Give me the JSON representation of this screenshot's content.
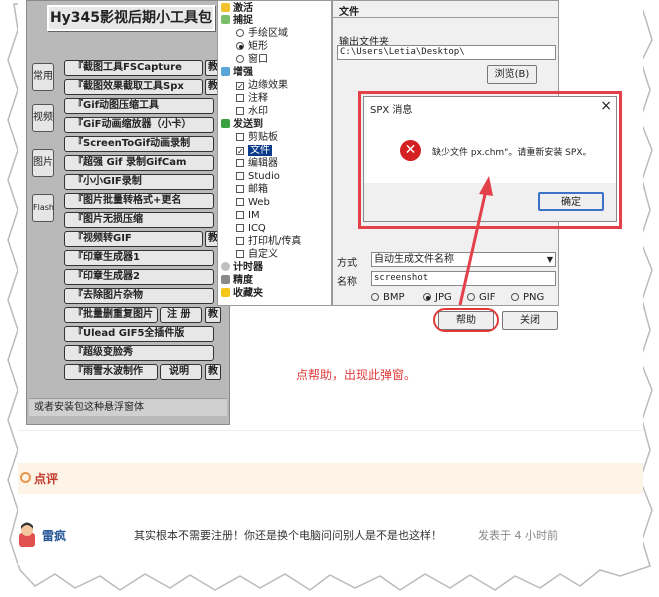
{
  "tool_panel": {
    "title": "Hy345影视后期小工具包",
    "side_buttons": [
      "常用",
      "视频",
      "图片",
      "Flash"
    ],
    "buttons": [
      {
        "label": "『截图工具FSCapture",
        "extra": "教"
      },
      {
        "label": "『截图效果截取工具Spx",
        "extra": "教"
      },
      {
        "label": "『Gif动图压缩工具",
        "extra": ""
      },
      {
        "label": "『GiF动画缩放器（小卡）",
        "extra": ""
      },
      {
        "label": "『ScreenToGif动画录制",
        "extra": ""
      },
      {
        "label": "『超强 Gif 录制GifCam",
        "extra": ""
      },
      {
        "label": "『小小GIF录制",
        "extra": ""
      },
      {
        "label": "『图片批量转格式+更名",
        "extra": ""
      },
      {
        "label": "『图片无损压缩",
        "extra": ""
      },
      {
        "label": "『视频转GIF",
        "extra": "教"
      },
      {
        "label": "『印章生成器1",
        "extra": ""
      },
      {
        "label": "『印章生成器2",
        "extra": ""
      },
      {
        "label": "『去除图片杂物",
        "extra": ""
      },
      {
        "label": "『批量删重复图片",
        "extra": "注 册",
        "extra2": "教"
      },
      {
        "label": "『Ulead GIF5全插件版",
        "extra": ""
      },
      {
        "label": "『超级变脸秀",
        "extra": ""
      },
      {
        "label": "『雨雪水波制作",
        "extra": "说明",
        "extra2": "教"
      }
    ],
    "footer": "或者安装包这种悬浮窗体"
  },
  "tree": {
    "items": [
      {
        "label": "激活",
        "kind": "section"
      },
      {
        "label": "捕捉",
        "kind": "section"
      },
      {
        "label": "手绘区域",
        "kind": "radio",
        "on": false
      },
      {
        "label": "矩形",
        "kind": "radio",
        "on": true
      },
      {
        "label": "窗口",
        "kind": "radio",
        "on": false
      },
      {
        "label": "增强",
        "kind": "section"
      },
      {
        "label": "边缘效果",
        "kind": "check",
        "on": true
      },
      {
        "label": "注释",
        "kind": "check",
        "on": false
      },
      {
        "label": "水印",
        "kind": "check",
        "on": false
      },
      {
        "label": "发送到",
        "kind": "section"
      },
      {
        "label": "剪贴板",
        "kind": "check",
        "on": false
      },
      {
        "label": "文件",
        "kind": "check",
        "on": true,
        "selected": true
      },
      {
        "label": "编辑器",
        "kind": "check",
        "on": false
      },
      {
        "label": "Studio",
        "kind": "check",
        "on": false
      },
      {
        "label": "邮箱",
        "kind": "check",
        "on": false
      },
      {
        "label": "Web",
        "kind": "check",
        "on": false
      },
      {
        "label": "IM",
        "kind": "check",
        "on": false
      },
      {
        "label": "ICQ",
        "kind": "check",
        "on": false
      },
      {
        "label": "打印机/传真",
        "kind": "check",
        "on": false
      },
      {
        "label": "自定义",
        "kind": "check",
        "on": false
      },
      {
        "label": "计时器",
        "kind": "section"
      },
      {
        "label": "精度",
        "kind": "section"
      },
      {
        "label": "收藏夹",
        "kind": "section"
      }
    ]
  },
  "settings": {
    "header": "文件",
    "output_folder_label": "输出文件夹",
    "output_folder_value": "C:\\Users\\Letia\\Desktop\\",
    "browse_label": "浏览(B)",
    "method_label": "方式",
    "method_value": "自动生成文件名称",
    "name_label": "名称",
    "name_value": "screenshot",
    "formats": [
      {
        "label": "BMP",
        "on": false
      },
      {
        "label": "JPG",
        "on": true
      },
      {
        "label": "GIF",
        "on": false
      },
      {
        "label": "PNG",
        "on": false
      }
    ],
    "help_label": "帮助",
    "close_label": "关闭"
  },
  "dialog": {
    "title": "SPX 消息",
    "message": "缺少文件   px.chm\"。请重新安装 SPX。",
    "ok_label": "确定"
  },
  "annotation": "点帮助，出现此弹窗。",
  "review": {
    "heading": "点评"
  },
  "comment": {
    "user": "雷疯",
    "text": "其实根本不需要注册！你还是换个电脑问问别人是不是也这样！",
    "time": "发表于 4 小时前"
  },
  "colors": {
    "highlight_red": "#e3404a",
    "review_bg": "#fdf3e7",
    "review_title": "#c0392b",
    "username": "#2a5a9a"
  }
}
